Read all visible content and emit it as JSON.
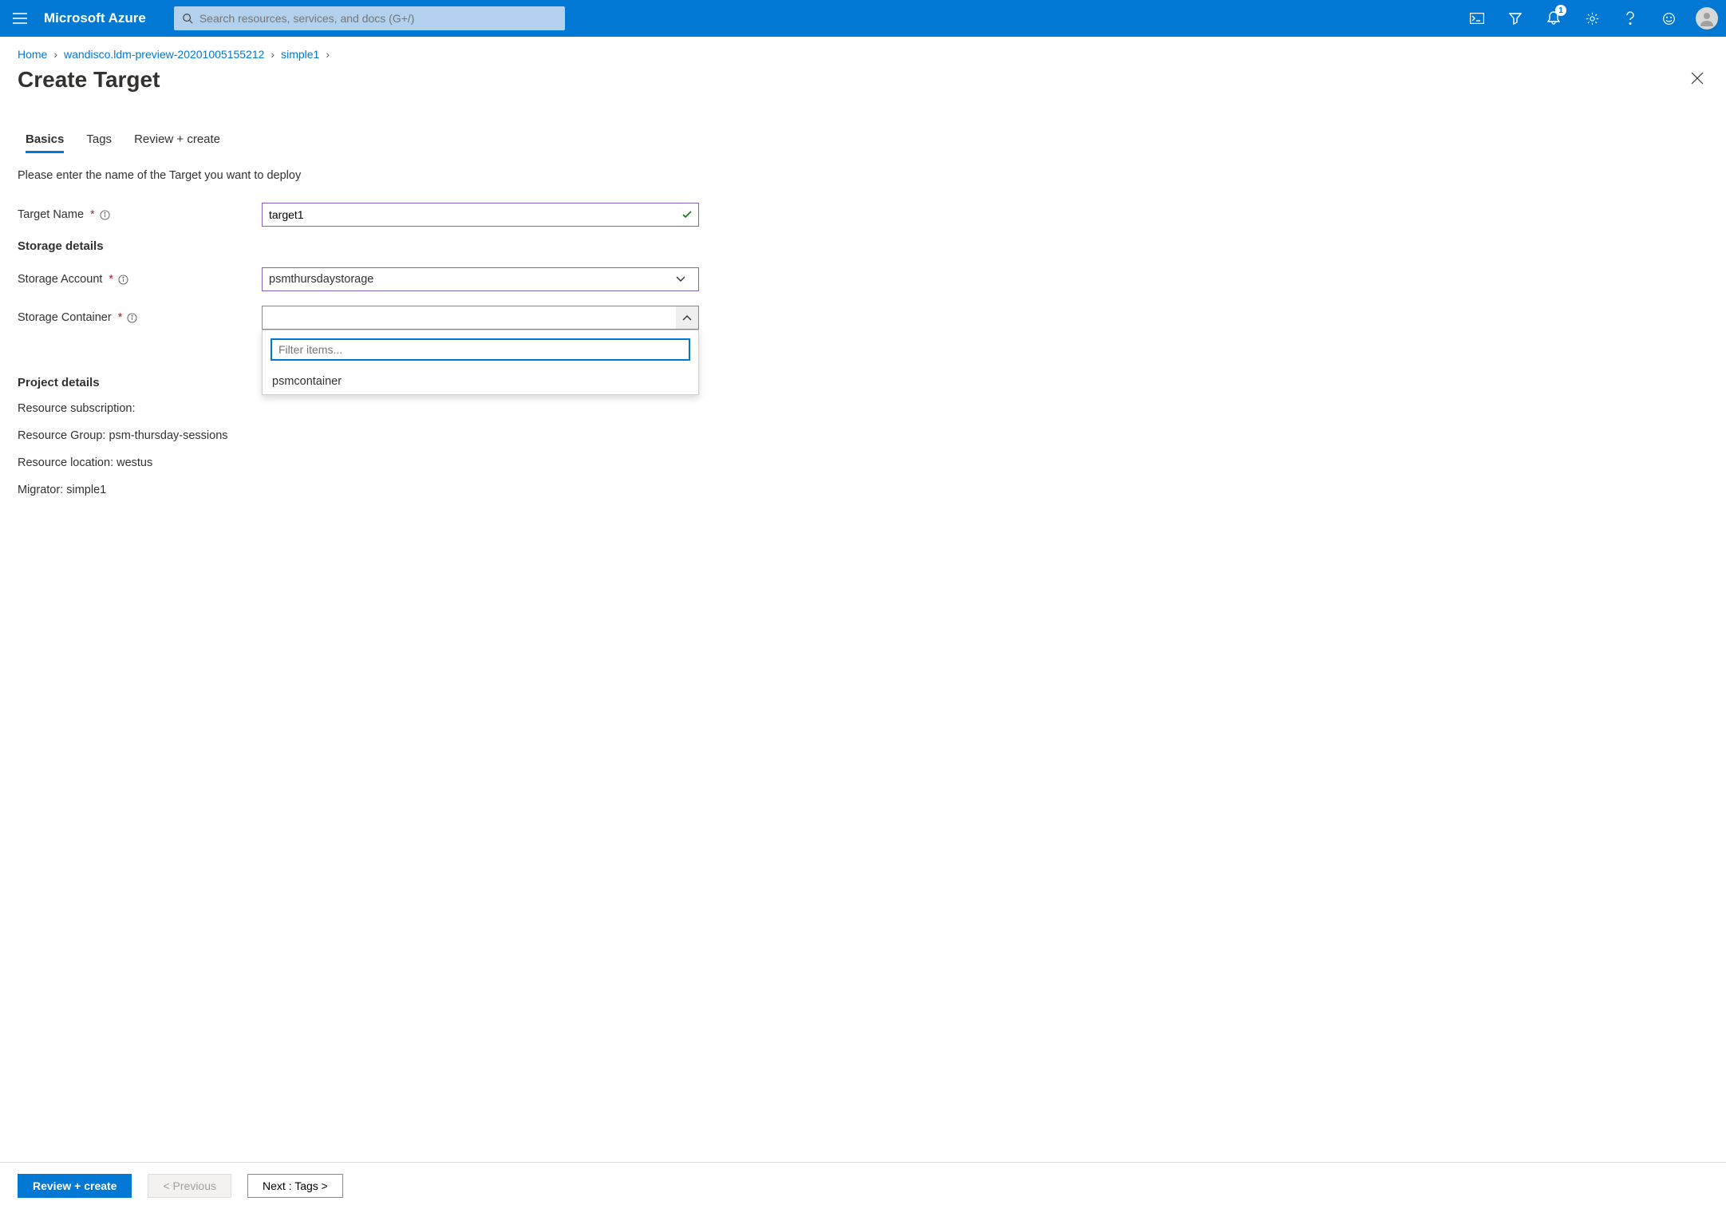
{
  "header": {
    "brand": "Microsoft Azure",
    "search_placeholder": "Search resources, services, and docs (G+/)",
    "notification_count": "1"
  },
  "breadcrumb": {
    "items": [
      "Home",
      "wandisco.ldm-preview-20201005155212",
      "simple1"
    ]
  },
  "page": {
    "title": "Create Target"
  },
  "tabs": [
    "Basics",
    "Tags",
    "Review + create"
  ],
  "form": {
    "intro": "Please enter the name of the Target you want to deploy",
    "target_name_label": "Target Name",
    "target_name_value": "target1",
    "storage_heading": "Storage details",
    "storage_account_label": "Storage Account",
    "storage_account_value": "psmthursdaystorage",
    "storage_container_label": "Storage Container",
    "storage_container_value": "",
    "filter_placeholder": "Filter items...",
    "container_options": [
      "psmcontainer"
    ],
    "project_heading": "Project details",
    "resource_subscription": "Resource subscription:",
    "resource_group": "Resource Group: psm-thursday-sessions",
    "resource_location": "Resource location: westus",
    "migrator": "Migrator: simple1"
  },
  "footer": {
    "review": "Review + create",
    "previous": "< Previous",
    "next": "Next : Tags >"
  }
}
